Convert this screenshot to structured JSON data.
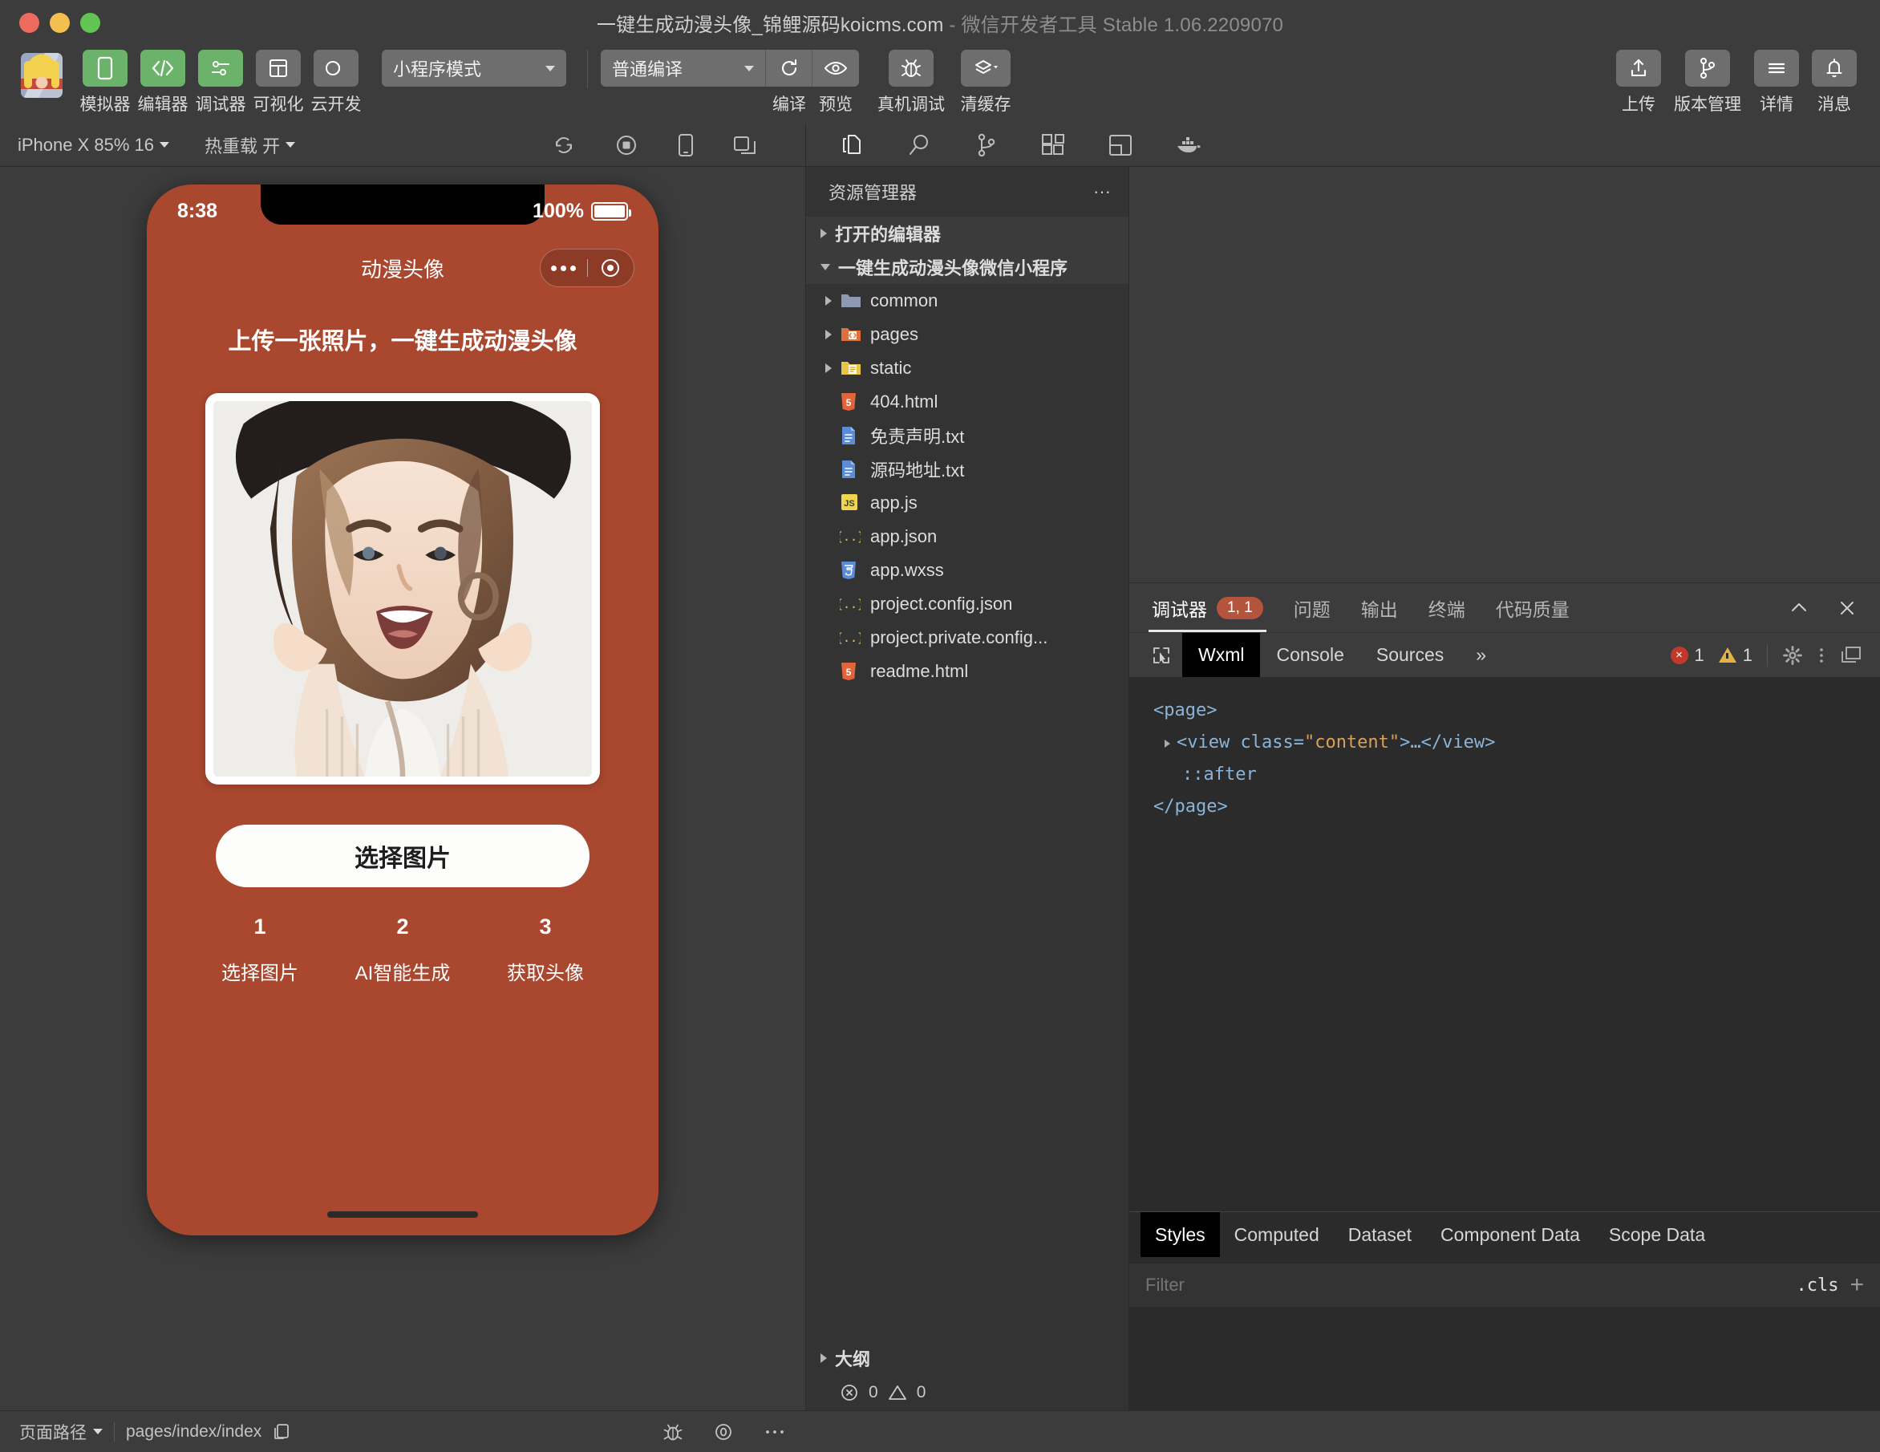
{
  "window": {
    "title": "一键生成动漫头像_锦鲤源码koicms.com",
    "title_dim": "- 微信开发者工具 Stable 1.06.2209070",
    "traffic_lights": [
      "close",
      "minimize",
      "maximize"
    ]
  },
  "toolbar": {
    "avatar_name": "user-avatar",
    "items": [
      {
        "label": "模拟器",
        "icon": "phone-icon",
        "state": "active"
      },
      {
        "label": "编辑器",
        "icon": "code-icon",
        "state": "active"
      },
      {
        "label": "调试器",
        "icon": "slider-icon",
        "state": "active"
      },
      {
        "label": "可视化",
        "icon": "layout-icon",
        "state": "inactive"
      },
      {
        "label": "云开发",
        "icon": "cloud-icon",
        "state": "inactive"
      }
    ],
    "mode_select": "小程序模式",
    "compile_select": "普通编译",
    "actions": [
      {
        "label": "编译",
        "icon": "refresh-icon"
      },
      {
        "label": "预览",
        "icon": "eye-icon"
      },
      {
        "label": "真机调试",
        "icon": "bug-icon"
      },
      {
        "label": "清缓存",
        "icon": "layers-icon"
      }
    ],
    "right_actions": [
      {
        "label": "上传",
        "icon": "upload-icon"
      },
      {
        "label": "版本管理",
        "icon": "branch-icon"
      },
      {
        "label": "详情",
        "icon": "menu-icon"
      },
      {
        "label": "消息",
        "icon": "bell-icon"
      }
    ]
  },
  "simbar": {
    "device": "iPhone X 85% 16",
    "hotreload": "热重载 开",
    "icons": [
      "rotate-icon",
      "record-icon",
      "device-icon",
      "detach-icon"
    ]
  },
  "activitybar": {
    "icons": [
      "files-icon",
      "search-icon",
      "source-control-icon",
      "extensions-icon",
      "layout-panel-icon",
      "docker-icon"
    ]
  },
  "simulator": {
    "status_time": "8:38",
    "battery_percent": "100%",
    "nav_title": "动漫头像",
    "headline": "上传一张照片，一键生成动漫头像",
    "pick_button": "选择图片",
    "steps": [
      {
        "num": "1",
        "label": "选择图片"
      },
      {
        "num": "2",
        "label": "AI智能生成"
      },
      {
        "num": "3",
        "label": "获取头像"
      }
    ],
    "theme_color": "#a9472f"
  },
  "explorer": {
    "title": "资源管理器",
    "more": "···",
    "open_editors": "打开的编辑器",
    "project": "一键生成动漫头像微信小程序",
    "outline": "大纲",
    "folders": [
      {
        "name": "common",
        "icon": "folder-icon",
        "color": "#8e98b3"
      },
      {
        "name": "pages",
        "icon": "folder-code-icon",
        "color": "#e0703a"
      },
      {
        "name": "static",
        "icon": "folder-asset-icon",
        "color": "#e8c547"
      }
    ],
    "files": [
      {
        "name": "404.html",
        "icon": "html-icon",
        "color": "#e2643a"
      },
      {
        "name": "免责声明.txt",
        "icon": "text-icon",
        "color": "#5b8cd8"
      },
      {
        "name": "源码地址.txt",
        "icon": "text-icon",
        "color": "#5b8cd8"
      },
      {
        "name": "app.js",
        "icon": "js-icon",
        "color": "#f0d64e"
      },
      {
        "name": "app.json",
        "icon": "json-icon",
        "color": "#e8c547"
      },
      {
        "name": "app.wxss",
        "icon": "wxss-icon",
        "color": "#5b8cd8"
      },
      {
        "name": "project.config.json",
        "icon": "json-icon",
        "color": "#e8c547"
      },
      {
        "name": "project.private.config...",
        "icon": "json-icon",
        "color": "#e8c547"
      },
      {
        "name": "readme.html",
        "icon": "html-icon",
        "color": "#e2643a"
      }
    ],
    "problems": {
      "errors": "0",
      "warnings": "0"
    }
  },
  "devtools": {
    "panel_tabs": [
      {
        "label": "调试器",
        "badge": "1, 1",
        "active": true
      },
      {
        "label": "问题",
        "active": false
      },
      {
        "label": "输出",
        "active": false
      },
      {
        "label": "终端",
        "active": false
      },
      {
        "label": "代码质量",
        "active": false
      }
    ],
    "panel_controls": [
      "collapse-icon",
      "close-icon"
    ],
    "inspector_tabs": [
      {
        "label": "Wxml",
        "active": true
      },
      {
        "label": "Console",
        "active": false
      },
      {
        "label": "Sources",
        "active": false
      },
      {
        "label": "more-tabs",
        "active": false
      }
    ],
    "more_glyph": "»",
    "error_count": "1",
    "warning_count": "1",
    "right_icons": [
      "gear-icon",
      "kebab-icon",
      "dock-icon"
    ],
    "wxml": {
      "line1": "<page>",
      "line2_open": "<view class=",
      "line2_val": "\"content\"",
      "line2_close": ">…</view>",
      "line3": "::after",
      "line4": "</page>"
    },
    "style_tabs": [
      {
        "label": "Styles",
        "active": true
      },
      {
        "label": "Computed",
        "active": false
      },
      {
        "label": "Dataset",
        "active": false
      },
      {
        "label": "Component Data",
        "active": false
      },
      {
        "label": "Scope Data",
        "active": false
      }
    ],
    "filter_placeholder": "Filter",
    "cls_label": ".cls",
    "plus_label": "+"
  },
  "statusbar": {
    "page_path_label": "页面路径",
    "page_path": "pages/index/index",
    "copy_icon": "copy-icon",
    "icons": [
      "bug-icon",
      "eye-icon",
      "more-icon"
    ]
  }
}
